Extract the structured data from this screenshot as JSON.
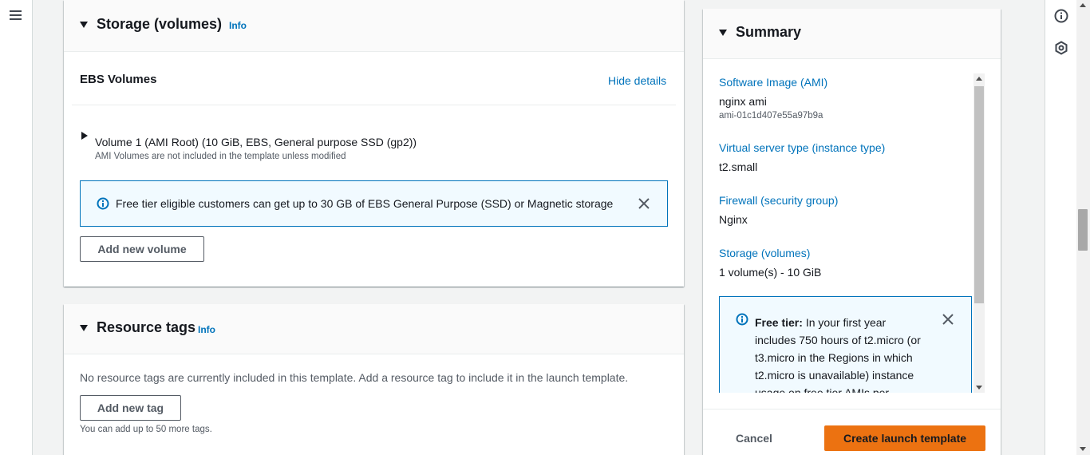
{
  "storage": {
    "title": "Storage (volumes)",
    "info": "Info",
    "ebs_title": "EBS Volumes",
    "hide_details": "Hide details",
    "volume_label": "Volume 1 (AMI Root) (10 GiB, EBS, General purpose SSD (gp2))",
    "volume_note": "AMI Volumes are not included in the template unless modified",
    "flash_text": "Free tier eligible customers can get up to 30 GB of EBS General Purpose (SSD) or Magnetic storage",
    "add_volume": "Add new volume"
  },
  "tags": {
    "title": "Resource tags",
    "info": "Info",
    "empty_text": "No resource tags are currently included in this template. Add a resource tag to include it in the launch template.",
    "add_tag": "Add new tag",
    "limit_note": "You can add up to 50 more tags."
  },
  "summary": {
    "title": "Summary",
    "ami_label": "Software Image (AMI)",
    "ami_name": "nginx ami",
    "ami_id": "ami-01c1d407e55a97b9a",
    "instance_label": "Virtual server type (instance type)",
    "instance_value": "t2.small",
    "firewall_label": "Firewall (security group)",
    "firewall_value": "Nginx",
    "storage_label": "Storage (volumes)",
    "storage_value": "1 volume(s) - 10 GiB",
    "free_tier_bold": "Free tier:",
    "free_tier_line1": "In your first year",
    "free_tier_line2": "includes 750 hours of t2.micro (or",
    "free_tier_line3": "t3.micro in the Regions in which",
    "free_tier_line4": "t2.micro is unavailable) instance",
    "free_tier_line5": "usage on free tier AMIs per",
    "cancel": "Cancel",
    "create": "Create launch template"
  },
  "icons": {
    "menu": "hamburger-menu-icon",
    "info": "info-circle-icon",
    "help": "info-icon",
    "feedback": "settings-hex-icon",
    "close": "close-icon"
  },
  "colors": {
    "link": "#0073bb",
    "primary": "#ec7211",
    "flash_bg": "#f1faff"
  }
}
